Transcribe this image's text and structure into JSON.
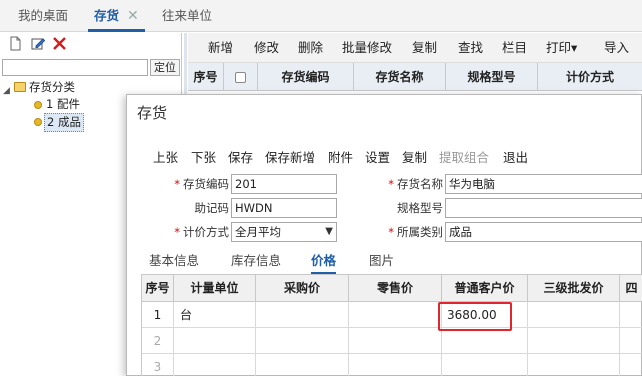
{
  "tabs": [
    {
      "label": "我的桌面"
    },
    {
      "label": "存货"
    },
    {
      "label": "往来单位"
    }
  ],
  "left_panel": {
    "locate_label": "定位",
    "tree": {
      "root": "存货分类",
      "children": [
        "1 配件",
        "2 成品"
      ],
      "selected_index": 1
    }
  },
  "bg_toolbar": [
    "新增",
    "修改",
    "删除",
    "批量修改",
    "复制",
    "查找",
    "栏目",
    "打印▾",
    "导入"
  ],
  "bg_table_headers": [
    "序号",
    "存货编码",
    "存货名称",
    "规格型号",
    "计价方式"
  ],
  "dialog": {
    "title": "存货",
    "toolbar": [
      {
        "label": "上张",
        "disabled": false
      },
      {
        "label": "下张",
        "disabled": false
      },
      {
        "label": "保存",
        "disabled": false
      },
      {
        "label": "保存新增",
        "disabled": false
      },
      {
        "label": "附件",
        "disabled": false
      },
      {
        "label": "设置",
        "disabled": false
      },
      {
        "label": "复制",
        "disabled": false
      },
      {
        "label": "提取组合",
        "disabled": true
      },
      {
        "label": "退出",
        "disabled": false
      }
    ],
    "fields": {
      "code_label": "存货编码",
      "code_value": "201",
      "name_label": "存货名称",
      "name_value": "华为电脑",
      "mnemonic_label": "助记码",
      "mnemonic_value": "HWDN",
      "spec_label": "规格型号",
      "spec_value": "",
      "pricing_label": "计价方式",
      "pricing_value": "全月平均",
      "category_label": "所属类别",
      "category_value": "成品"
    },
    "subtabs": [
      "基本信息",
      "库存信息",
      "价格",
      "图片"
    ],
    "active_subtab": 2,
    "grid": {
      "headers": [
        "序号",
        "计量单位",
        "采购价",
        "零售价",
        "普通客户价",
        "三级批发价",
        "四"
      ],
      "rows": [
        {
          "no": "1",
          "unit": "台",
          "purchase": "",
          "retail": "",
          "normal_price": "3680.00",
          "level3": ""
        },
        {
          "no": "2",
          "unit": "",
          "purchase": "",
          "retail": "",
          "normal_price": "",
          "level3": ""
        },
        {
          "no": "3",
          "unit": "",
          "purchase": "",
          "retail": "",
          "normal_price": "",
          "level3": ""
        }
      ]
    }
  },
  "colors": {
    "accent": "#1f5fa8",
    "highlight": "#e0262c"
  }
}
